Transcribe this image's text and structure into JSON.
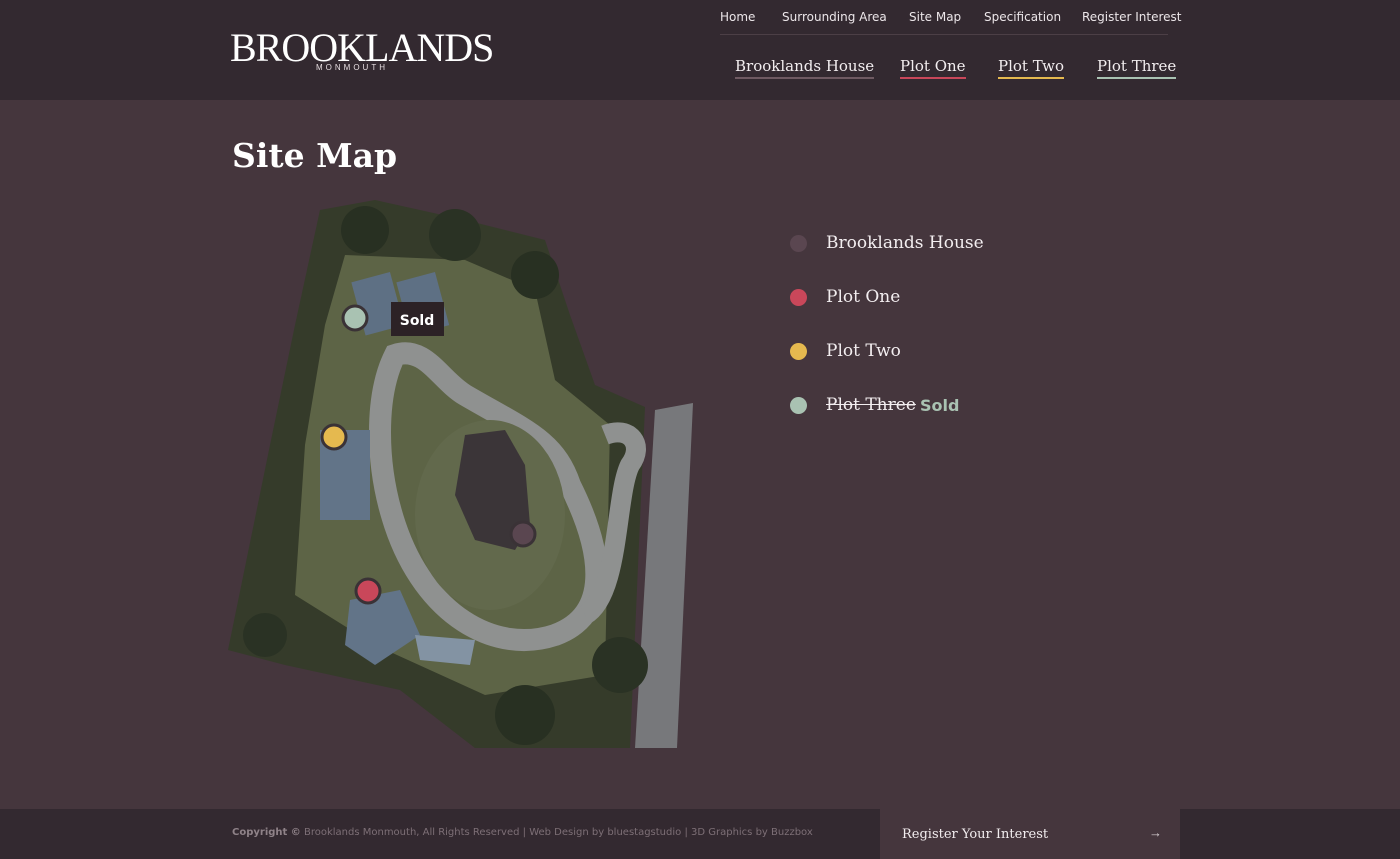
{
  "logo": {
    "main": "BROOKLANDS",
    "sub": "MONMOUTH"
  },
  "top_nav": [
    "Home",
    "Surrounding  Area",
    "Site Map",
    "Specification",
    "Register Interest"
  ],
  "main_nav": [
    {
      "label": "Brooklands House",
      "color": "#6f5a62"
    },
    {
      "label": "Plot One",
      "color": "#c9475a"
    },
    {
      "label": "Plot Two",
      "color": "#e5b94f"
    },
    {
      "label": "Plot Three",
      "color": "#a9c2b2"
    }
  ],
  "page_title": "Site Map",
  "map": {
    "sold_tag": "Sold"
  },
  "legend": [
    {
      "label": "Brooklands House",
      "color": "#5a4650",
      "sold": false
    },
    {
      "label": "Plot One",
      "color": "#c9475a",
      "sold": false
    },
    {
      "label": "Plot Two",
      "color": "#e5b94f",
      "sold": false
    },
    {
      "label": "Plot Three",
      "color": "#a9c2b2",
      "sold": true,
      "sold_label": "Sold"
    }
  ],
  "footer": {
    "copyright_bold": "Copyright ©",
    "copyright_text": " Brooklands Monmouth, All Rights Reserved | Web Design by bluestagstudio | 3D Graphics by Buzzbox",
    "register_label": "Register Your Interest",
    "register_arrow": "→"
  }
}
